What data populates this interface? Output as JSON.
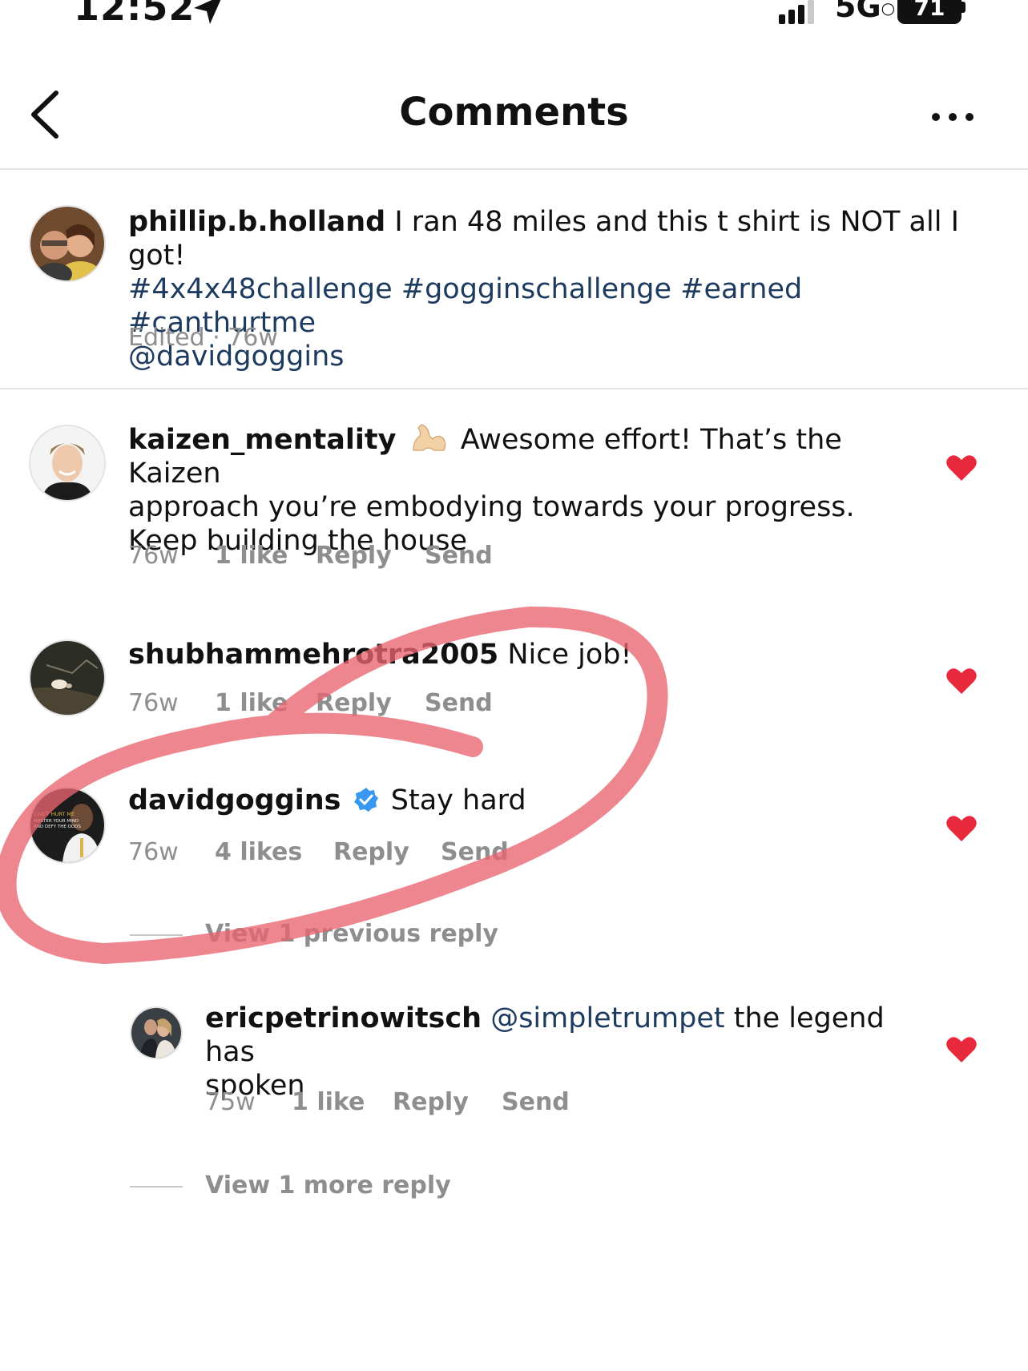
{
  "status_bar": {
    "time": "12:52",
    "network": "5G",
    "battery": "71"
  },
  "header": {
    "title": "Comments"
  },
  "post": {
    "username": "phillip.b.holland",
    "caption": "I ran 48 miles and this t shirt is NOT all I got!",
    "hashtags": "#4x4x48challenge #gogginschallenge #earned #canthurtme",
    "mention": "@davidgoggins",
    "meta": "Edited · 76w"
  },
  "comments": [
    {
      "username": "kaizen_mentality",
      "emoji": "flexed-biceps",
      "text_line1": "Awesome effort! That’s the Kaizen",
      "text_line2": "approach you’re embodying towards your progress.",
      "text_line3": "Keep building the house",
      "time": "76w",
      "likes": "1 like",
      "reply": "Reply",
      "send": "Send"
    },
    {
      "username": "shubhammehrotra2005",
      "text": "Nice job!",
      "time": "76w",
      "likes": "1 like",
      "reply": "Reply",
      "send": "Send"
    },
    {
      "username": "davidgoggins",
      "verified": true,
      "text": "Stay hard",
      "time": "76w",
      "likes": "4 likes",
      "reply": "Reply",
      "send": "Send",
      "view_previous": "View 1 previous reply",
      "reply_item": {
        "username": "ericpetrinowitsch",
        "mention": "@simpletrumpet",
        "text_line1": "the legend has",
        "text_line2": "spoken",
        "time": "75w",
        "likes": "1 like",
        "reply": "Reply",
        "send": "Send"
      },
      "view_more": "View 1 more reply"
    }
  ],
  "avatar_badge_text": [
    "CAN'T HURT ME",
    "MASTER YOUR MIND",
    "AND DEFY THE ODDS"
  ],
  "colors": {
    "heart": "#e8283b",
    "annotation": "#e86470",
    "verified": "#3897f0",
    "hashtag": "#1d3a5f",
    "muted": "#8e8e8e"
  }
}
